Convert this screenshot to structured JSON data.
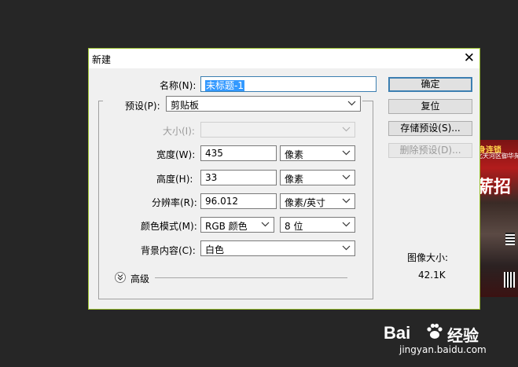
{
  "window": {
    "title": "新建",
    "close_label": "✕"
  },
  "form": {
    "name": {
      "label": "名称(N):",
      "value": "未标题-1"
    },
    "preset": {
      "label": "预设(P):",
      "value": "剪贴板"
    },
    "size": {
      "label": "大小(I):",
      "value": ""
    },
    "width": {
      "label": "宽度(W):",
      "value": "435",
      "unit": "像素"
    },
    "height": {
      "label": "高度(H):",
      "value": "33",
      "unit": "像素"
    },
    "resolution": {
      "label": "分辨率(R):",
      "value": "96.012",
      "unit": "像素/英寸"
    },
    "color_mode": {
      "label": "颜色模式(M):",
      "value": "RGB 颜色",
      "depth": "8 位"
    },
    "background": {
      "label": "背景内容(C):",
      "value": "白色"
    },
    "advanced": {
      "label": "高级"
    }
  },
  "buttons": {
    "ok": "确定",
    "reset": "复位",
    "save_preset": "存储预设(S)...",
    "delete_preset": "删除预设(D)..."
  },
  "image_size": {
    "label": "图像大小:",
    "value": "42.1K"
  },
  "background_poster": {
    "line1": "身连锁",
    "line2": "北天河区御华苑",
    "headline": "薪招"
  },
  "watermark": {
    "brand": "Bai",
    "brand_suffix": "经验",
    "url": "jingyan.baidu.com"
  },
  "colors": {
    "accent": "#3399ff",
    "dialog_border": "#9bc12f",
    "desktop": "#262626"
  }
}
